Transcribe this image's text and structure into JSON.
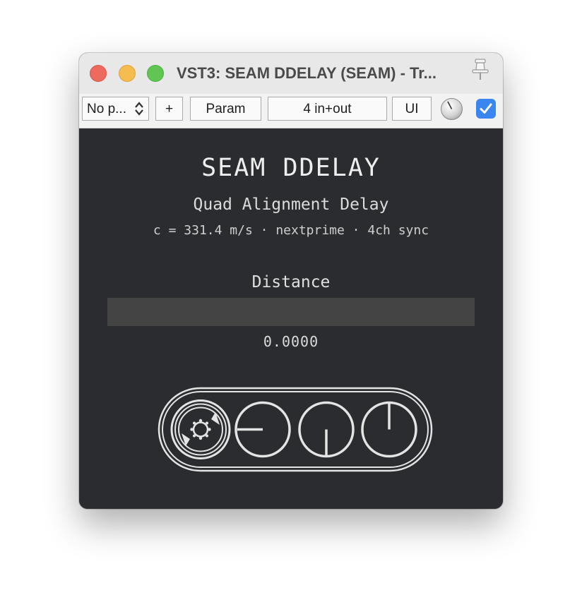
{
  "window": {
    "title": "VST3: SEAM DDELAY (SEAM) - Tr..."
  },
  "toolbar": {
    "preset": "No p...",
    "plus": "+",
    "param": "Param",
    "io": "4 in+out",
    "ui": "UI",
    "bypass_checked": true
  },
  "plugin": {
    "title": "SEAM DDELAY",
    "subtitle": "Quad Alignment Delay",
    "info": "c = 331.4 m/s · nextprime · 4ch sync"
  },
  "param": {
    "label": "Distance",
    "value_text": "0.0000",
    "fraction": 0
  },
  "colors": {
    "background": "#2a2c2f",
    "slider_track": "#444445",
    "accent_blue": "#3a86f0"
  },
  "icons": [
    "pin-icon",
    "chevron-updown-icon",
    "knob-icon",
    "checkmark-icon",
    "seam-logo"
  ]
}
